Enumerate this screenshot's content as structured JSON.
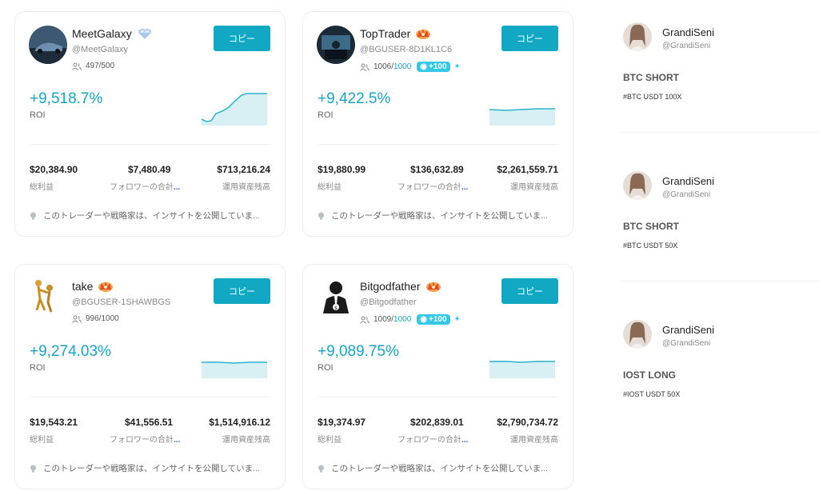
{
  "copy_label": "コピー",
  "labels": {
    "roi": "ROI",
    "total_pnl": "総利益",
    "followers_total": "フォロワーの合計",
    "aum": "運用資産残高",
    "ellipsis": "..."
  },
  "colors": {
    "accent": "#12a8c4",
    "roi": "#1aa3c1",
    "boost": "#35c7e6"
  },
  "traders": [
    {
      "name": "MeetGalaxy",
      "badge": "diamond-icon",
      "handle": "@MeetGalaxy",
      "followers": "497/500",
      "followers_cap": "",
      "boost": "",
      "roi": "+9,518.7%",
      "total_pnl": "$20,384.90",
      "followers_pnl": "$7,480.49",
      "aum": "$713,216.24",
      "insight": "このトレーダーや戦略家は、インサイトを公開していま..."
    },
    {
      "name": "TopTrader",
      "badge": "crown-icon",
      "handle": "@BGUSER-8D1KL1C6",
      "followers": "1006/",
      "followers_cap": "1000",
      "boost": "+100",
      "roi": "+9,422.5%",
      "total_pnl": "$19,880.99",
      "followers_pnl": "$136,632.89",
      "aum": "$2,261,559.71",
      "insight": "このトレーダーや戦略家は、インサイトを公開していま..."
    },
    {
      "name": "take",
      "badge": "crown-icon",
      "handle": "@BGUSER-1SHAWBGS",
      "followers": "996/1000",
      "followers_cap": "",
      "boost": "",
      "roi": "+9,274.03%",
      "total_pnl": "$19,543.21",
      "followers_pnl": "$41,556.51",
      "aum": "$1,514,916.12",
      "insight": "このトレーダーや戦略家は、インサイトを公開していま..."
    },
    {
      "name": "Bitgodfather",
      "badge": "crown-icon",
      "handle": "@Bitgodfather",
      "followers": "1009/",
      "followers_cap": "1000",
      "boost": "+100",
      "roi": "+9,089.75%",
      "total_pnl": "$19,374.97",
      "followers_pnl": "$202,839.01",
      "aum": "$2,790,734.72",
      "insight": "このトレーダーや戦略家は、インサイトを公開していま..."
    }
  ],
  "posts": [
    {
      "name": "GrandiSeni",
      "handle": "@GrandiSeni",
      "title": "BTC SHORT",
      "tags": "#BTC USDT 100X"
    },
    {
      "name": "GrandiSeni",
      "handle": "@GrandiSeni",
      "title": "BTC SHORT",
      "tags": "#BTC USDT 50X"
    },
    {
      "name": "GrandiSeni",
      "handle": "@GrandiSeni",
      "title": "IOST LONG",
      "tags": "#IOST USDT 50X"
    }
  ]
}
